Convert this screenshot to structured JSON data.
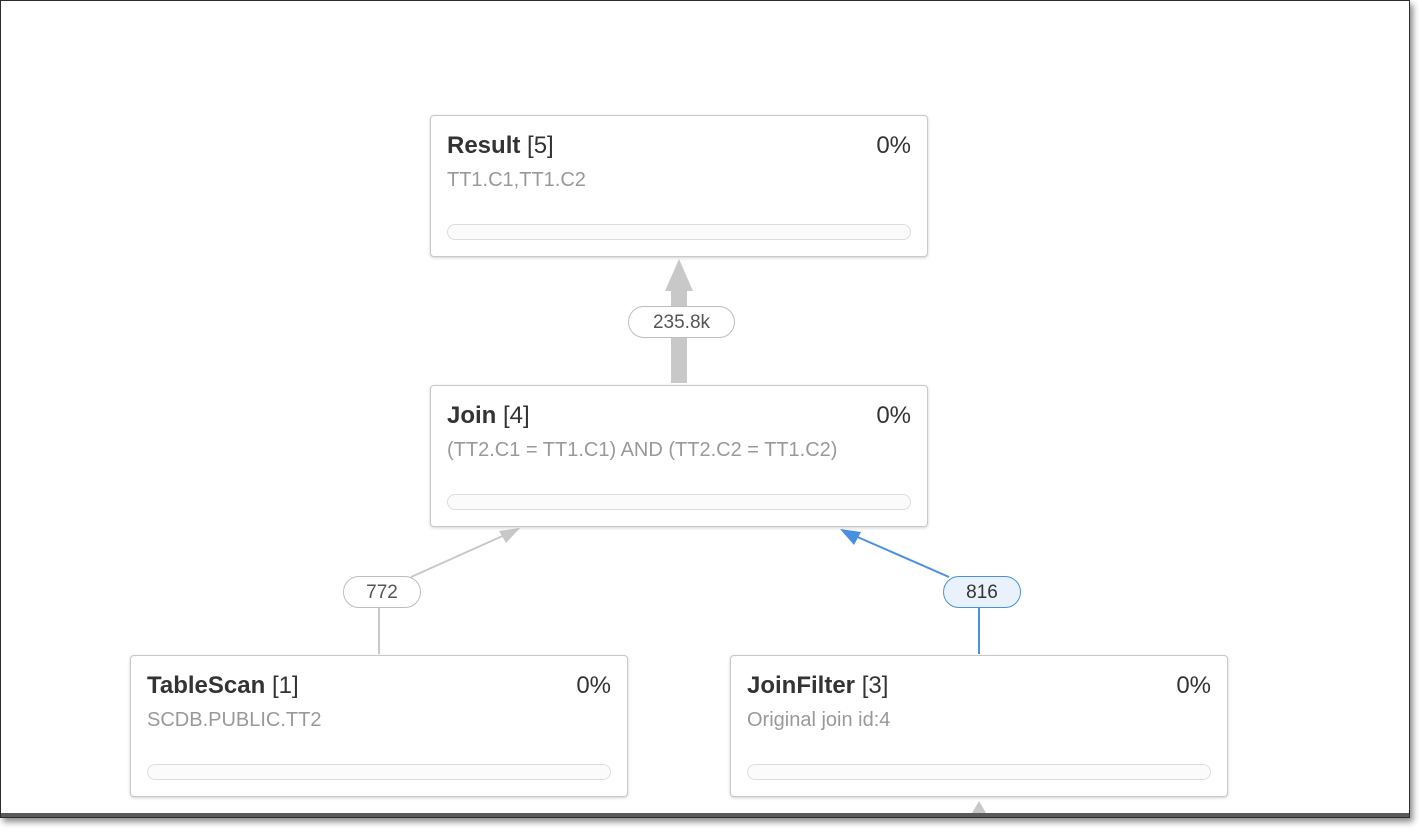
{
  "nodes": [
    {
      "op": "Result",
      "id": "[5]",
      "pct": "0%",
      "detail": "TT1.C1,TT1.C2",
      "progress": 0
    },
    {
      "op": "Join",
      "id": "[4]",
      "pct": "0%",
      "detail": "(TT2.C1 = TT1.C1) AND (TT2.C2 = TT1.C2)",
      "progress": 0
    },
    {
      "op": "TableScan",
      "id": "[1]",
      "pct": "0%",
      "detail": "SCDB.PUBLIC.TT2",
      "progress": 0
    },
    {
      "op": "JoinFilter",
      "id": "[3]",
      "pct": "0%",
      "detail": "Original join id:4",
      "progress": 0
    }
  ],
  "edges": [
    {
      "label": "235.8k",
      "from": "Join [4]",
      "to": "Result [5]",
      "selected": false
    },
    {
      "label": "772",
      "from": "TableScan [1]",
      "to": "Join [4]",
      "selected": false
    },
    {
      "label": "816",
      "from": "JoinFilter [3]",
      "to": "Join [4]",
      "selected": true
    }
  ],
  "colors": {
    "edge": "#c8c8c8",
    "edge_selected": "#4a90e2",
    "node_border": "#c9c9c9",
    "title_text": "#333333",
    "detail_text": "#999999"
  }
}
